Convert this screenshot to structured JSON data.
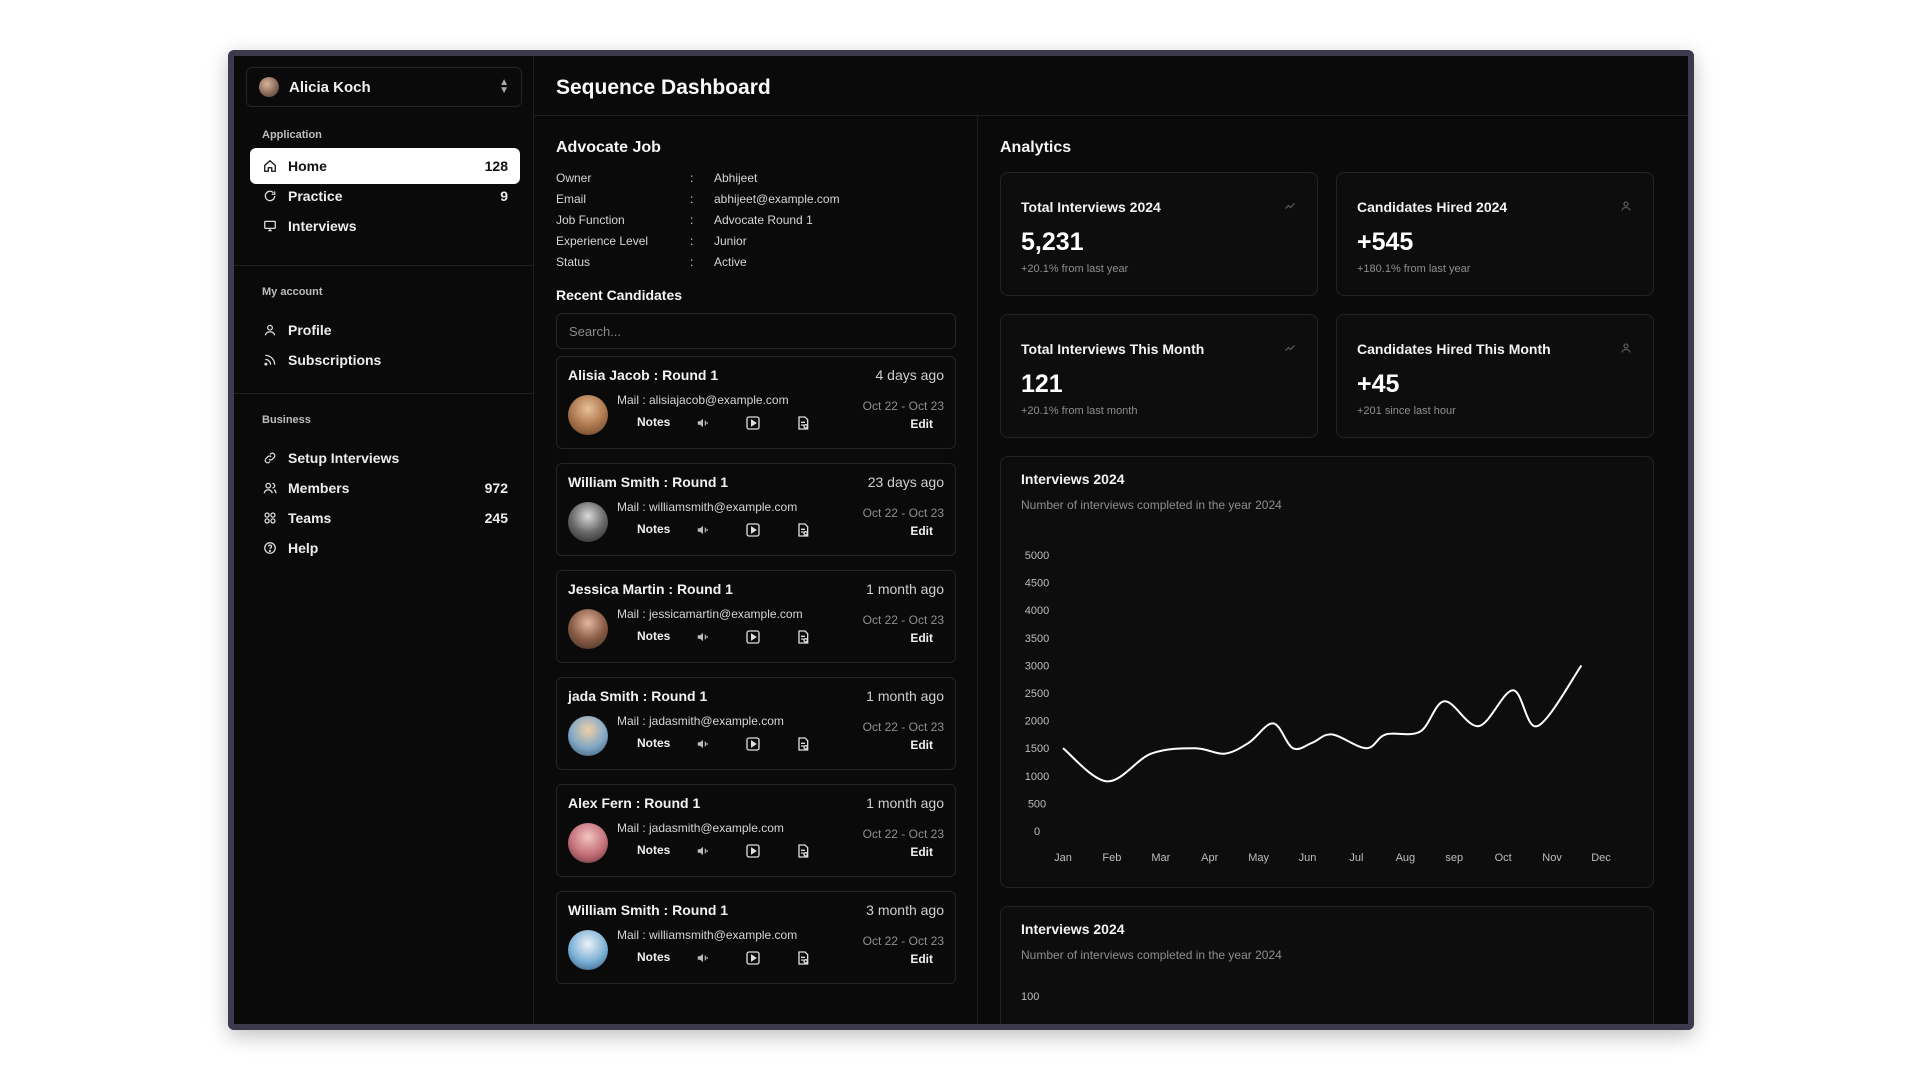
{
  "user": {
    "name": "Alicia Koch"
  },
  "page_title": "Sequence Dashboard",
  "sidebar": {
    "application_label": "Application",
    "application_items": [
      {
        "label": "Home",
        "count": "128",
        "icon": "home-icon"
      },
      {
        "label": "Practice",
        "count": "9",
        "icon": "refresh-icon"
      },
      {
        "label": "Interviews",
        "count": "",
        "icon": "monitor-icon"
      }
    ],
    "account_label": "My account",
    "account_items": [
      {
        "label": "Profile",
        "icon": "user-icon"
      },
      {
        "label": "Subscriptions",
        "icon": "rss-icon"
      }
    ],
    "business_label": "Business",
    "business_items": [
      {
        "label": "Setup Interviews",
        "count": "",
        "icon": "link-icon"
      },
      {
        "label": "Members",
        "count": "972",
        "icon": "users-icon"
      },
      {
        "label": "Teams",
        "count": "245",
        "icon": "grid-icon"
      },
      {
        "label": "Help",
        "count": "",
        "icon": "help-icon"
      }
    ]
  },
  "job": {
    "title": "Advocate Job",
    "fields": [
      {
        "key": "Owner",
        "value": "Abhijeet"
      },
      {
        "key": "Email",
        "value": "abhijeet@example.com"
      },
      {
        "key": "Job Function",
        "value": "Advocate Round 1"
      },
      {
        "key": "Experience Level",
        "value": "Junior"
      },
      {
        "key": "Status",
        "value": "Active"
      }
    ],
    "separator": ":"
  },
  "recent": {
    "title": "Recent Candidates",
    "search_placeholder": "Search...",
    "notes_label": "Notes",
    "edit_label": "Edit",
    "candidates": [
      {
        "name": "Alisia Jacob  : Round 1",
        "ago": "4 days ago",
        "mail": "Mail : alisiajacob@example.com",
        "dates": "Oct 22   -   Oct 23"
      },
      {
        "name": "William Smith : Round 1",
        "ago": "23 days ago",
        "mail": "Mail : williamsmith@example.com",
        "dates": "Oct 22   -   Oct 23"
      },
      {
        "name": "Jessica Martin : Round 1",
        "ago": "1 month ago",
        "mail": "Mail : jessicamartin@example.com",
        "dates": "Oct 22   -   Oct 23"
      },
      {
        "name": "jada Smith : Round 1",
        "ago": "1 month ago",
        "mail": "Mail : jadasmith@example.com",
        "dates": "Oct 22   -   Oct 23"
      },
      {
        "name": "Alex Fern : Round 1",
        "ago": "1 month ago",
        "mail": "Mail : jadasmith@example.com",
        "dates": "Oct 22   -   Oct 23"
      },
      {
        "name": "William Smith : Round 1",
        "ago": "3 month ago",
        "mail": "Mail : williamsmith@example.com",
        "dates": "Oct 22   -   Oct 23"
      }
    ]
  },
  "analytics": {
    "title": "Analytics",
    "stats": [
      {
        "title": "Total Interviews 2024",
        "value": "5,231",
        "sub": "+20.1% from last year",
        "icon": "trend-icon"
      },
      {
        "title": "Candidates Hired 2024",
        "value": "+545",
        "sub": "+180.1% from last year",
        "icon": "user-icon"
      },
      {
        "title": "Total Interviews This Month",
        "value": "121",
        "sub": "+20.1% from last month",
        "icon": "trend-icon"
      },
      {
        "title": "Candidates Hired This Month",
        "value": "+45",
        "sub": "+201 since last hour",
        "icon": "user-icon"
      }
    ],
    "chart1": {
      "title": "Interviews  2024",
      "subtitle": "Number of interviews completed in the year 2024"
    },
    "chart2": {
      "title": "Interviews  2024",
      "subtitle": "Number of interviews completed in the year 2024",
      "first_tick": "100"
    }
  },
  "chart_data": [
    {
      "type": "line",
      "title": "Interviews  2024",
      "subtitle": "Number of interviews completed in the year 2024",
      "categories": [
        "Jan",
        "Feb",
        "Mar",
        "Apr",
        "May",
        "Jun",
        "Jul",
        "Aug",
        "sep",
        "Oct",
        "Nov",
        "Dec"
      ],
      "yticks": [
        0,
        500,
        1000,
        1500,
        2000,
        2500,
        3000,
        3500,
        4000,
        4500,
        5000
      ],
      "ylim": [
        0,
        5000
      ],
      "grid": false,
      "series": [
        {
          "values": [
            1500,
            900,
            1400,
            1500,
            1400,
            1600,
            1950,
            1500,
            1600,
            1750,
            1500,
            1750,
            1800,
            2350,
            1900,
            2550,
            1900,
            3000
          ],
          "x": [
            0,
            0.9,
            1.8,
            2.7,
            3.3,
            3.8,
            4.3,
            4.7,
            5.1,
            5.5,
            6.2,
            6.6,
            7.3,
            7.8,
            8.5,
            9.2,
            9.7,
            10.6
          ]
        }
      ]
    },
    {
      "type": "line",
      "title": "Interviews  2024",
      "subtitle": "Number of interviews completed in the year 2024",
      "yticks": [
        100
      ]
    }
  ]
}
